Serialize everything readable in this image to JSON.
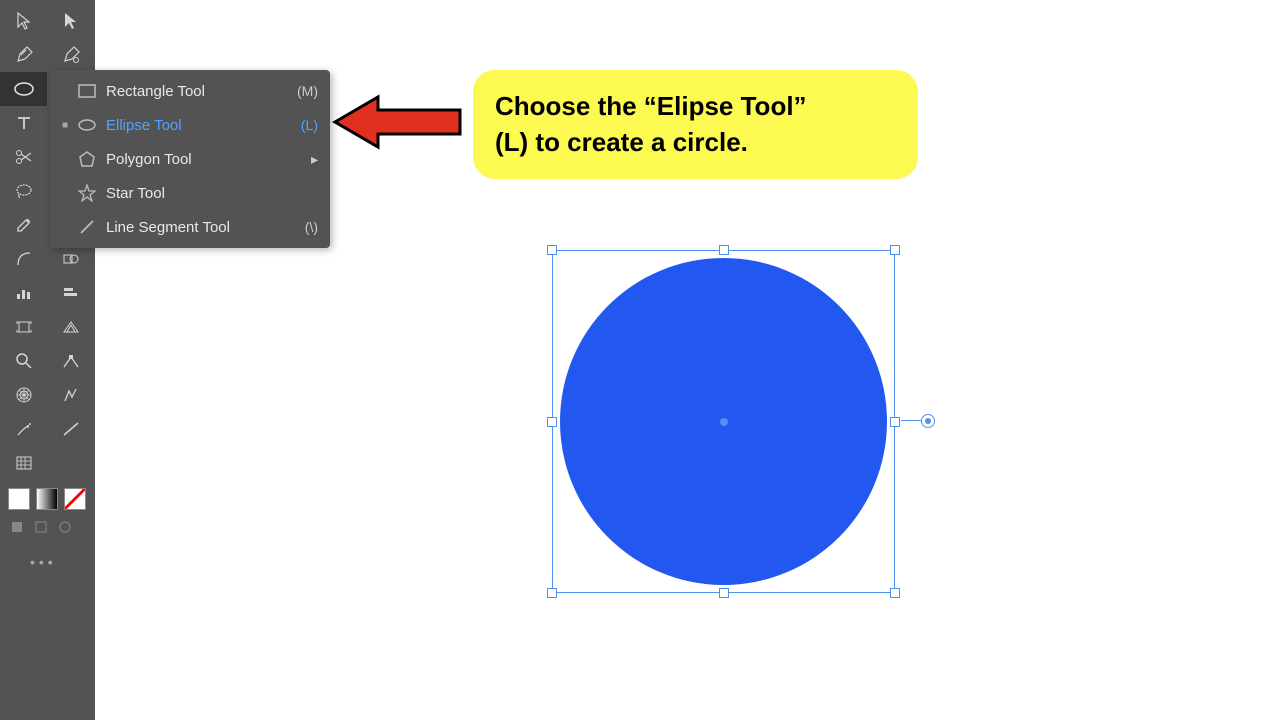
{
  "callout": {
    "line1": "Choose the “Elipse Tool”",
    "line2": "(L) to create a circle."
  },
  "flyout": {
    "items": [
      {
        "label": "Rectangle Tool",
        "shortcut": "(M)",
        "selected": false,
        "icon": "rect"
      },
      {
        "label": "Ellipse Tool",
        "shortcut": "(L)",
        "selected": true,
        "icon": "ellipse"
      },
      {
        "label": "Polygon Tool",
        "shortcut": "",
        "selected": false,
        "icon": "polygon",
        "submenu": true
      },
      {
        "label": "Star Tool",
        "shortcut": "",
        "selected": false,
        "icon": "star"
      },
      {
        "label": "Line Segment Tool",
        "shortcut": "(\\)",
        "selected": false,
        "icon": "line"
      }
    ]
  },
  "canvas": {
    "shape": "circle",
    "fill": "#2358f0",
    "selection_color": "#4f8ff0"
  }
}
